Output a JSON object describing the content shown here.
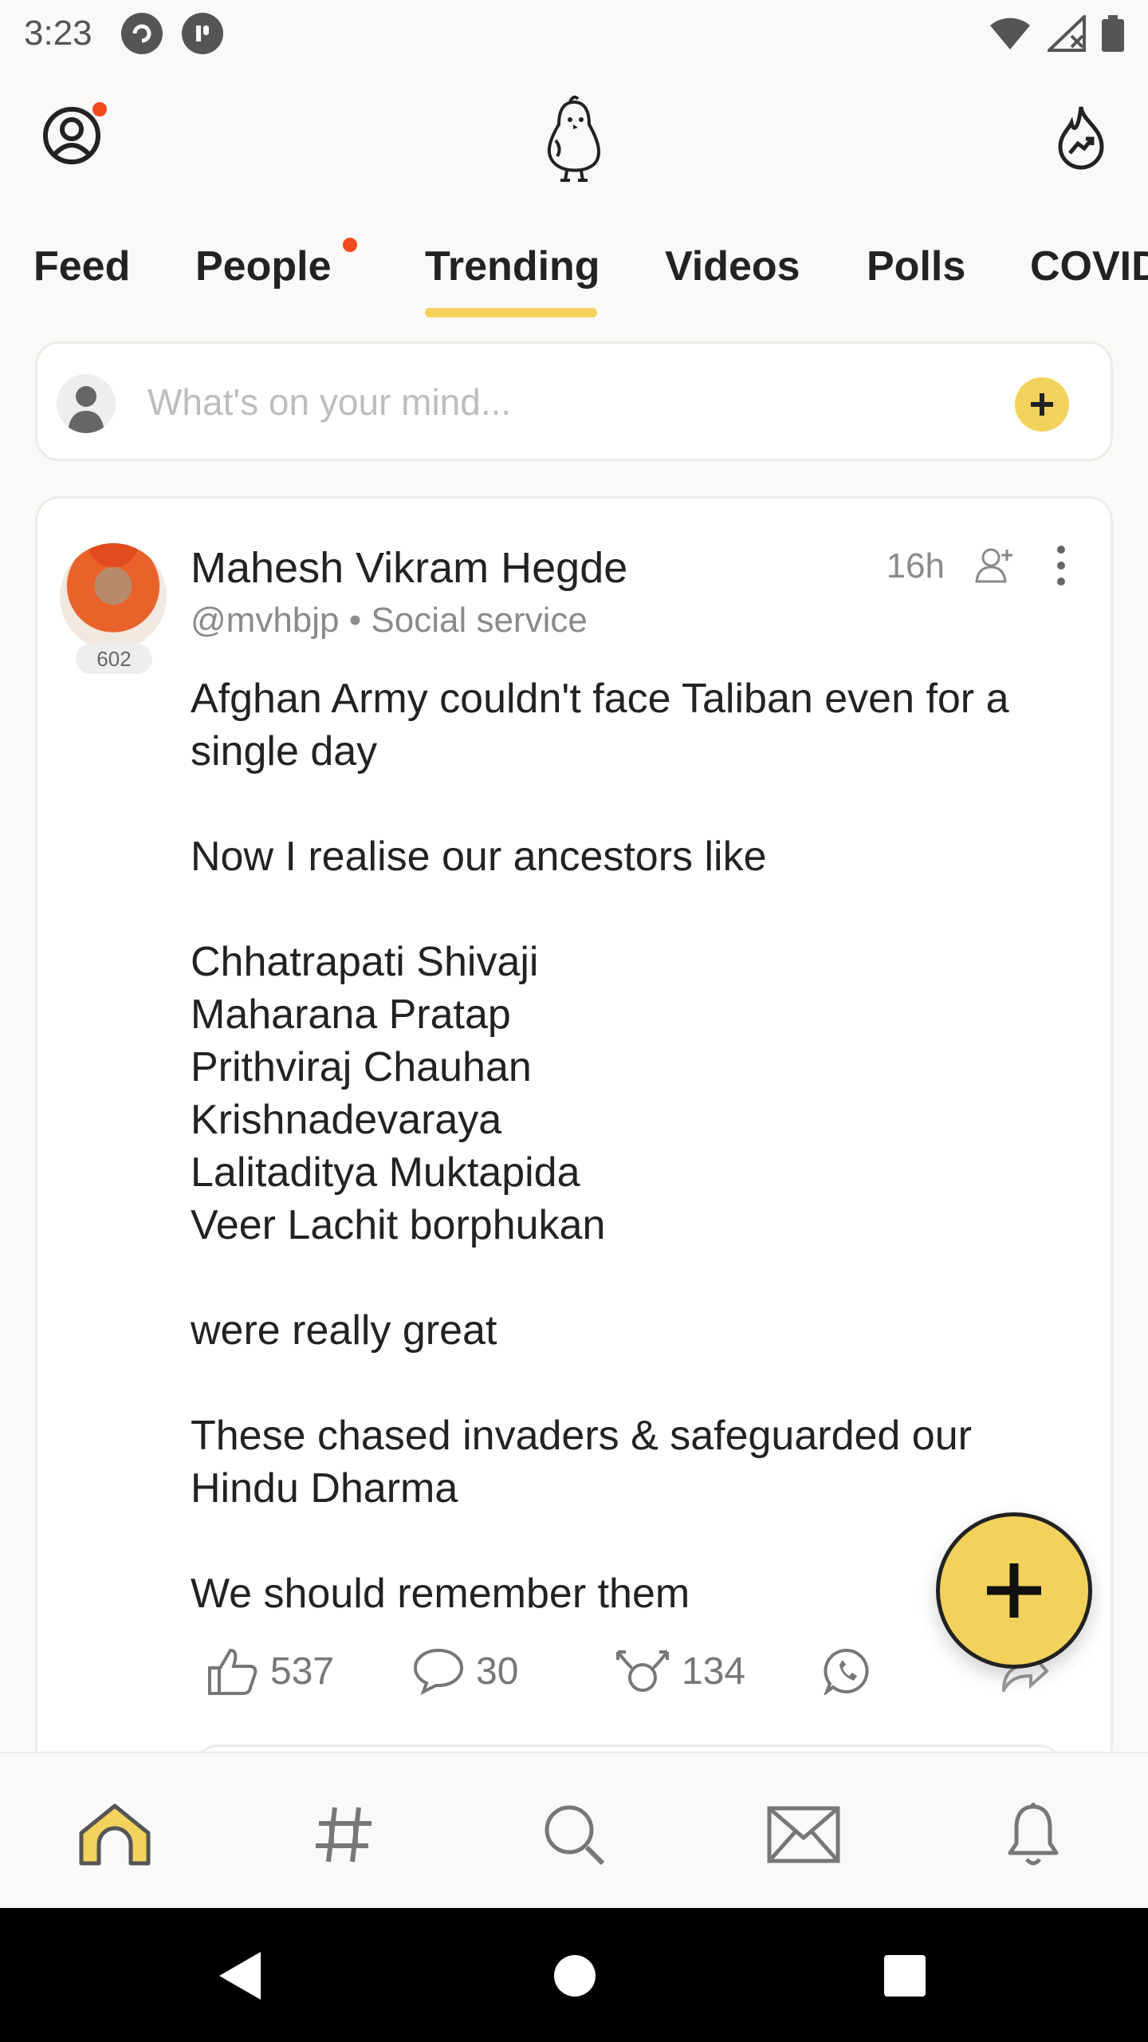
{
  "status_bar": {
    "time": "3:23"
  },
  "top_bar": {},
  "tabs": [
    {
      "label": "Feed",
      "active": false
    },
    {
      "label": "People",
      "active": false,
      "has_dot": true
    },
    {
      "label": "Trending",
      "active": true
    },
    {
      "label": "Videos",
      "active": false
    },
    {
      "label": "Polls",
      "active": false
    },
    {
      "label": "COVID",
      "active": false
    }
  ],
  "composer": {
    "placeholder": "What's on your mind..."
  },
  "post": {
    "author_name": "Mahesh Vikram Hegde",
    "handle": "@mvhbjp",
    "category": "Social service",
    "meta_separator": " • ",
    "avatar_badge": "602",
    "time": "16h",
    "body": "Afghan Army couldn't face Taliban even for a single day\n\nNow I realise our ancestors like\n\nChhatrapati Shivaji\nMaharana Pratap\nPrithviraj Chauhan\nKrishnadevaraya\nLalitaditya Muktapida\nVeer Lachit borphukan\n\nwere really great\n\nThese chased invaders & safeguarded our Hindu Dharma\n\nWe should remember them",
    "likes": "537",
    "comments": "30",
    "rekoos": "134"
  },
  "colors": {
    "accent": "#f2d25c",
    "notification_dot": "#f24a1d",
    "text": "#222222",
    "muted": "#8a8a8a"
  },
  "bottom_nav": [
    "home-icon",
    "hashtag-icon",
    "search-icon",
    "mail-icon",
    "bell-icon"
  ]
}
